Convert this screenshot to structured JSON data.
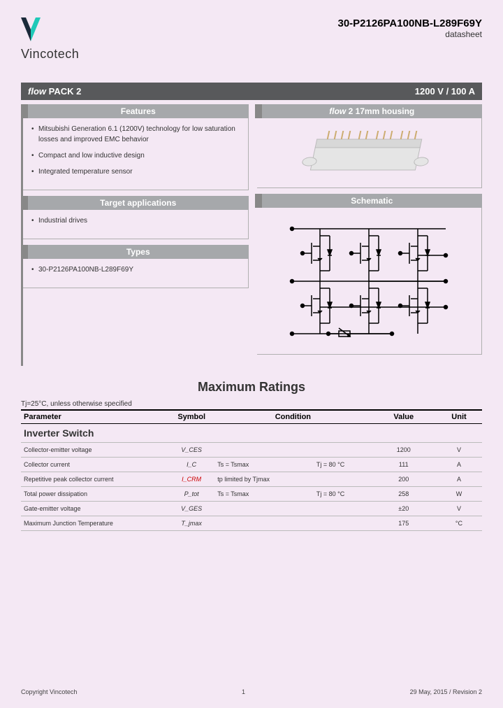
{
  "header": {
    "company": "Vincotech",
    "part_number": "30-P2126PA100NB-L289F69Y",
    "doc_type": "datasheet"
  },
  "title_bar": {
    "left_italic": "flow",
    "left_rest": "PACK 2",
    "right": "1200 V / 100 A"
  },
  "features": {
    "title": "Features",
    "items": [
      "Mitsubishi Generation 6.1 (1200V) technology for low saturation losses and improved EMC behavior",
      "Compact and low inductive design",
      "Integrated temperature sensor"
    ]
  },
  "target_apps": {
    "title": "Target applications",
    "items": [
      "Industrial drives"
    ]
  },
  "types": {
    "title": "Types",
    "items": [
      "30-P2126PA100NB-L289F69Y"
    ]
  },
  "housing": {
    "title_italic": "flow",
    "title_rest": " 2 17mm housing"
  },
  "schematic": {
    "title": "Schematic"
  },
  "max_ratings": {
    "title": "Maximum Ratings",
    "condition_note": "Tj=25°C, unless otherwise specified",
    "headers": {
      "parameter": "Parameter",
      "symbol": "Symbol",
      "condition": "Condition",
      "value": "Value",
      "unit": "Unit"
    },
    "section": "Inverter Switch",
    "rows": [
      {
        "param": "Collector-emitter voltage",
        "sym": "V_CES",
        "cond1": "",
        "cond2": "",
        "val": "1200",
        "unit": "V"
      },
      {
        "param": "Collector current",
        "sym": "I_C",
        "cond1": "Ts = Tsmax",
        "cond2": "Tj = 80 °C",
        "val": "111",
        "unit": "A"
      },
      {
        "param": "Repetitive peak collector current",
        "sym": "I_CRM",
        "sym_red": true,
        "cond1": "tp limited by Tjmax",
        "cond2": "",
        "val": "200",
        "unit": "A"
      },
      {
        "param": "Total power dissipation",
        "sym": "P_tot",
        "cond1": "Ts = Tsmax",
        "cond2": "Tj = 80 °C",
        "val": "258",
        "unit": "W"
      },
      {
        "param": "Gate-emitter voltage",
        "sym": "V_GES",
        "cond1": "",
        "cond2": "",
        "val": "±20",
        "unit": "V"
      },
      {
        "param": "Maximum Junction Temperature",
        "sym": "T_jmax",
        "cond1": "",
        "cond2": "",
        "val": "175",
        "unit": "°C"
      }
    ]
  },
  "footer": {
    "copyright": "Copyright Vincotech",
    "page": "1",
    "date_rev": "29 May, 2015 / Revision 2"
  }
}
